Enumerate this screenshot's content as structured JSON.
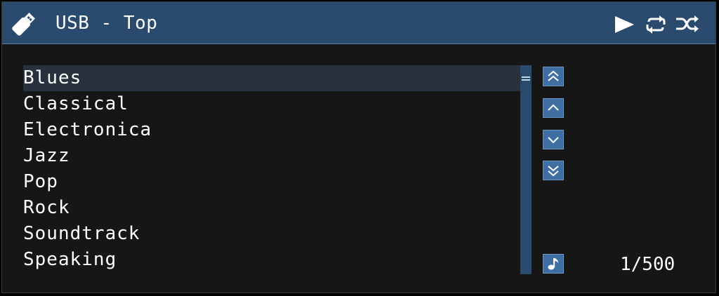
{
  "header": {
    "title": "USB - Top",
    "icons": [
      "usb-icon",
      "play-icon",
      "repeat-icon",
      "shuffle-icon"
    ]
  },
  "list": {
    "items": [
      "Blues",
      "Classical",
      "Electronica",
      "Jazz",
      "Pop",
      "Rock",
      "Soundtrack",
      "Speaking"
    ],
    "selected_index": 0
  },
  "nav": {
    "icons": [
      "page-up-icon",
      "up-icon",
      "down-icon",
      "page-down-icon",
      "music-note-icon"
    ]
  },
  "counter": "1/500",
  "colors": {
    "header_bg": "#2a4a6e",
    "background": "#161616",
    "selected_row": "#28323f",
    "button_bg": "#3f6ea3"
  }
}
